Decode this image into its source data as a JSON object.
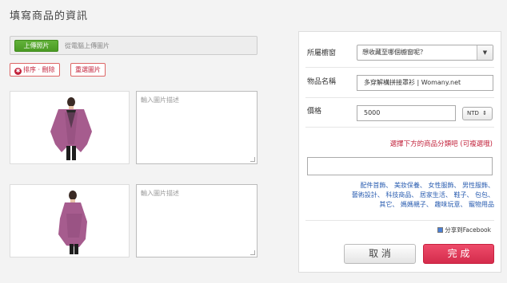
{
  "page": {
    "title": "填寫商品的資訊"
  },
  "upload": {
    "button_label": "上傳照片",
    "hint": "從電腦上傳圖片"
  },
  "photo_actions": {
    "sort_delete_label": "排序 · 刪除",
    "reselect_label": "重選圖片"
  },
  "photos": [
    {
      "desc_placeholder": "輸入圖片描述"
    },
    {
      "desc_placeholder": "輸入圖片描述"
    }
  ],
  "form": {
    "window_label": "所屬櫥窗",
    "window_value": "想收藏至哪個櫥窗呢？",
    "name_label": "物品名稱",
    "name_value": "多穿解構拼接罩衫 | Womany.net",
    "price_label": "價格",
    "price_value": "5000",
    "currency": "NTD",
    "category_prompt": "選擇下方的商品分類吧 (可複選哦)",
    "categories": [
      "配件首飾",
      "美妝保養",
      "女性服飾",
      "男性服飾",
      "藝術設計",
      "科技商品",
      "居家生活",
      "鞋子",
      "包包",
      "其它",
      "媽媽親子",
      "趣味玩意",
      "寵物用品"
    ],
    "share_label": "分享到Facebook",
    "cancel_label": "取 消",
    "done_label": "完 成"
  },
  "colors": {
    "accent_red": "#c2223b",
    "upload_green": "#4a9a24",
    "link_blue": "#2a5db0",
    "garment_purple": "#a65c8e"
  }
}
